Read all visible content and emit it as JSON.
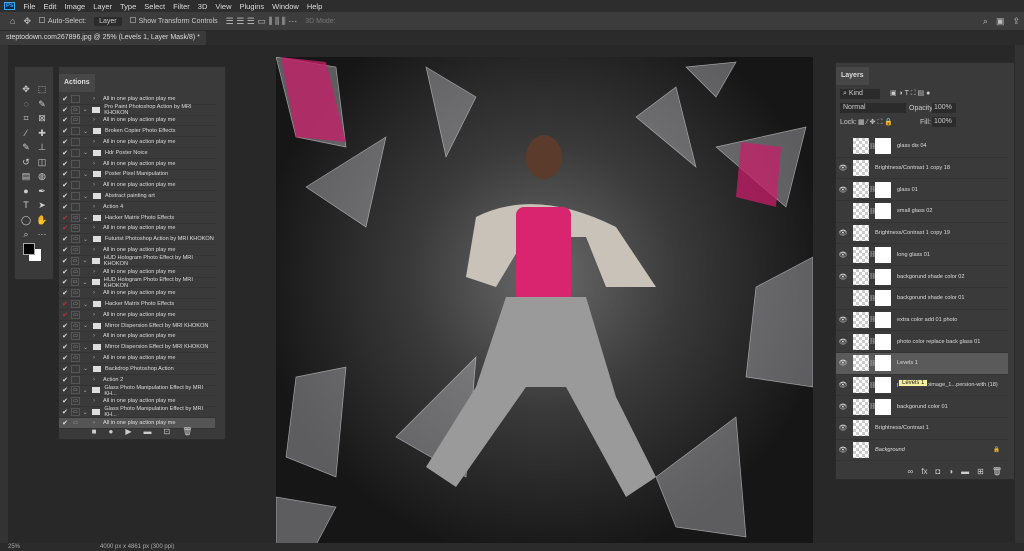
{
  "menu": [
    "File",
    "Edit",
    "Image",
    "Layer",
    "Type",
    "Select",
    "Filter",
    "3D",
    "View",
    "Plugins",
    "Window",
    "Help"
  ],
  "app_logo": "Ps",
  "options": {
    "auto_select": "Auto-Select:",
    "layer_select": "Layer",
    "show_transform": "Show Transform Controls",
    "mode_3d": "3D Mode:"
  },
  "document_tab": "steptodown.com267896.jpg @ 25% (Levels 1, Layer Mask/8) *",
  "actions_panel": {
    "title": "Actions",
    "rows": [
      {
        "t": "All in one play action play me",
        "f": false,
        "red": false,
        "dlg": false
      },
      {
        "t": "Pro Paint Photoshop Action by MRI KHOKON",
        "f": true,
        "red": false,
        "dlg": true
      },
      {
        "t": "All in one play action play me",
        "f": false,
        "red": false,
        "dlg": true
      },
      {
        "t": "Broken Copier Photo Effects",
        "f": true,
        "red": false,
        "dlg": false
      },
      {
        "t": "All in one play action play me",
        "f": false,
        "red": false,
        "dlg": false
      },
      {
        "t": "Hdr Poster Noice",
        "f": true,
        "red": false,
        "dlg": false
      },
      {
        "t": "All in one play action play me",
        "f": false,
        "red": false,
        "dlg": false
      },
      {
        "t": "Poster Pixel Manipulation",
        "f": true,
        "red": false,
        "dlg": false
      },
      {
        "t": "All in one play action play me",
        "f": false,
        "red": false,
        "dlg": false
      },
      {
        "t": "Abstract painting art",
        "f": true,
        "red": false,
        "dlg": false
      },
      {
        "t": "Action 4",
        "f": false,
        "red": false,
        "dlg": false
      },
      {
        "t": "Hacker Matrix Photo Effects",
        "f": true,
        "red": true,
        "dlg": true
      },
      {
        "t": "All in one play action play me",
        "f": false,
        "red": true,
        "dlg": true
      },
      {
        "t": "Futurist Photoshop Action by MRI KHOKON",
        "f": true,
        "red": false,
        "dlg": true
      },
      {
        "t": "All in one play action play me",
        "f": false,
        "red": false,
        "dlg": true
      },
      {
        "t": "HUD Hologram Photo Effect by MRI KHOKON",
        "f": true,
        "red": false,
        "dlg": true
      },
      {
        "t": "All in one play action play me",
        "f": false,
        "red": false,
        "dlg": true
      },
      {
        "t": "HUD Hologram Photo Effect by MRI KHOKON",
        "f": true,
        "red": false,
        "dlg": true
      },
      {
        "t": "All in one play action play me",
        "f": false,
        "red": false,
        "dlg": true
      },
      {
        "t": "Hacker Matrix Photo Effects",
        "f": true,
        "red": true,
        "dlg": true
      },
      {
        "t": "All in one play action play me",
        "f": false,
        "red": true,
        "dlg": true
      },
      {
        "t": "Mirror Dispersion Effect by MRI KHOKON",
        "f": true,
        "red": false,
        "dlg": true
      },
      {
        "t": "All in one play action play me",
        "f": false,
        "red": false,
        "dlg": true
      },
      {
        "t": "Mirror Dispersion Effect by MRI KHOKON",
        "f": true,
        "red": false,
        "dlg": true
      },
      {
        "t": "All in one play action play me",
        "f": false,
        "red": false,
        "dlg": true
      },
      {
        "t": "Backdrop Photoshop Action",
        "f": true,
        "red": false,
        "dlg": false
      },
      {
        "t": "Action 2",
        "f": false,
        "red": false,
        "dlg": false
      },
      {
        "t": "Glass Photo Manipulation Effect by MRI KH...",
        "f": true,
        "red": false,
        "dlg": true
      },
      {
        "t": "All in one play action play me",
        "f": false,
        "red": false,
        "dlg": true
      },
      {
        "t": "Glass Photo Manipulation Effect by MRI KH...",
        "f": true,
        "red": false,
        "dlg": true
      },
      {
        "t": "All in one play action play me",
        "f": false,
        "red": false,
        "dlg": true,
        "sel": true
      }
    ]
  },
  "layers_panel": {
    "title": "Layers",
    "filter": "Kind",
    "blend_mode": "Normal",
    "opacity_label": "Opacity:",
    "opacity": "100%",
    "lock_label": "Lock:",
    "fill_label": "Fill:",
    "fill": "100%",
    "layers": [
      {
        "name": "glass dis 04",
        "visible": false
      },
      {
        "name": "Brightness/Contrast 1 copy 18",
        "visible": true
      },
      {
        "name": "glass 01",
        "visible": true
      },
      {
        "name": "small glass 02",
        "visible": false
      },
      {
        "name": "Brightness/Contrast 1 copy 19",
        "visible": true
      },
      {
        "name": "long glass 01",
        "visible": true
      },
      {
        "name": "backgorund shade color 02",
        "visible": true
      },
      {
        "name": "backgorund shade color 01",
        "visible": false
      },
      {
        "name": "extra color add 01 photo",
        "visible": true
      },
      {
        "name": "photo color replace back glass 01",
        "visible": true
      },
      {
        "name": "Levels 1",
        "visible": true,
        "selected": true
      },
      {
        "name": "pikaso_texttoimage_1...persion-with (18)",
        "visible": true
      },
      {
        "name": "backgorund color 01",
        "visible": true
      },
      {
        "name": "Brightness/Contrast 1",
        "visible": true
      },
      {
        "name": "Background",
        "visible": true
      }
    ],
    "tooltip": "Levels 1"
  },
  "status": {
    "zoom": "25%",
    "doc_size": "4000 px x 4861 px (300 ppi)"
  }
}
